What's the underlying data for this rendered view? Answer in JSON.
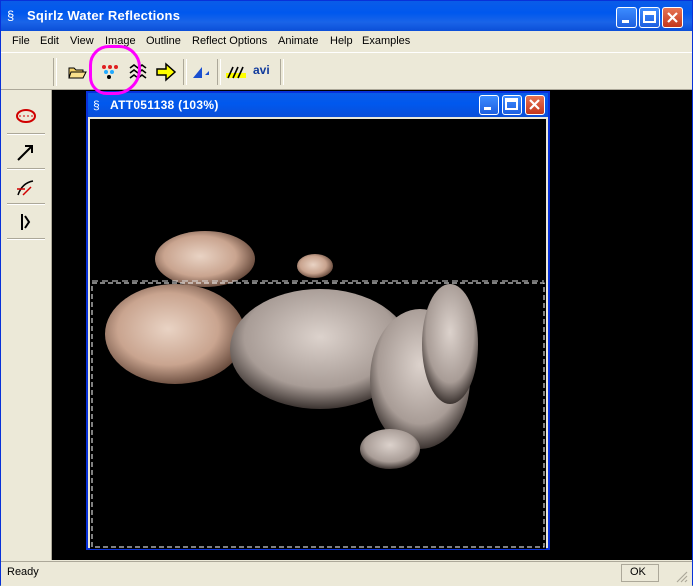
{
  "app": {
    "title": "Sqirlz Water Reflections"
  },
  "menu": [
    "File",
    "Edit",
    "View",
    "Image",
    "Outline",
    "Reflect Options",
    "Animate",
    "Help",
    "Examples"
  ],
  "toolbar": {
    "avi_label": "avi"
  },
  "child_window": {
    "title": "ATT051138  (103%)"
  },
  "status": {
    "left": "Ready",
    "right": "OK"
  },
  "colors": {
    "titlebar": "#0058ee",
    "highlight": "#ff00ff",
    "face": "#ece9d8"
  },
  "icons": {
    "toolbar": [
      "open-folder-icon",
      "palette-icon",
      "waves-icon",
      "arrow-right-icon",
      "triangle-icon",
      "stripes-icon",
      "avi-icon"
    ],
    "sidebar": [
      "ellipse-outline-icon",
      "arrow-tool-icon",
      "curve-tool-icon",
      "split-tool-icon"
    ]
  }
}
